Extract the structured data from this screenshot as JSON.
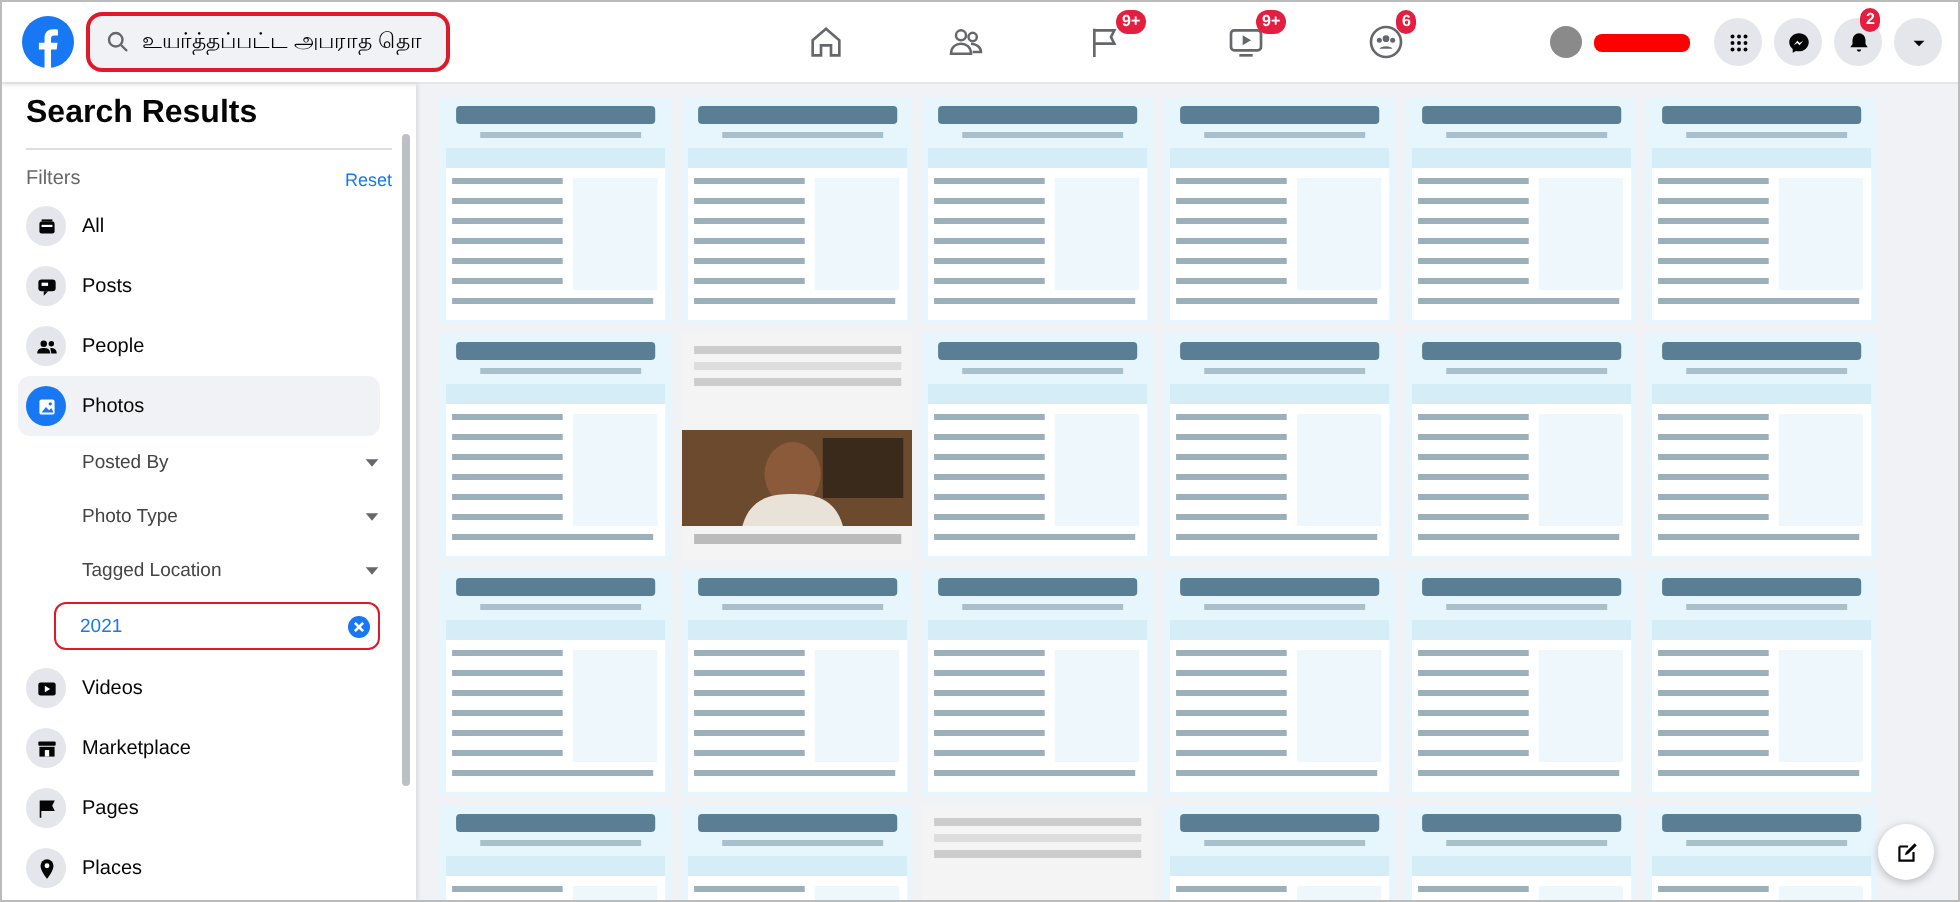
{
  "search": {
    "value": "உயர்த்தப்பட்ட அபராத தொ",
    "highlighted": true
  },
  "nav": [
    {
      "kind": "home"
    },
    {
      "kind": "friends"
    },
    {
      "kind": "pages",
      "badge": "9+"
    },
    {
      "kind": "watch",
      "badge": "9+"
    },
    {
      "kind": "groups",
      "badge": "6"
    }
  ],
  "account": {
    "name_redacted": true
  },
  "actions": [
    {
      "kind": "menu"
    },
    {
      "kind": "messenger"
    },
    {
      "kind": "notifications",
      "badge": "2"
    },
    {
      "kind": "account"
    }
  ],
  "sidebar": {
    "title": "Search Results",
    "filters_label": "Filters",
    "reset": "Reset",
    "items": [
      {
        "kind": "all",
        "label": "All",
        "selected": false
      },
      {
        "kind": "posts",
        "label": "Posts",
        "selected": false
      },
      {
        "kind": "people",
        "label": "People",
        "selected": false
      },
      {
        "kind": "photos",
        "label": "Photos",
        "selected": true,
        "subfilters": [
          {
            "label": "Posted By"
          },
          {
            "label": "Photo Type"
          },
          {
            "label": "Tagged Location"
          }
        ],
        "chip": {
          "value": "2021",
          "highlighted": true
        }
      },
      {
        "kind": "videos",
        "label": "Videos",
        "selected": false
      },
      {
        "kind": "marketplace",
        "label": "Marketplace",
        "selected": false
      },
      {
        "kind": "pages",
        "label": "Pages",
        "selected": false
      },
      {
        "kind": "places",
        "label": "Places",
        "selected": false
      }
    ]
  },
  "compose": {
    "kind": "new-message"
  }
}
